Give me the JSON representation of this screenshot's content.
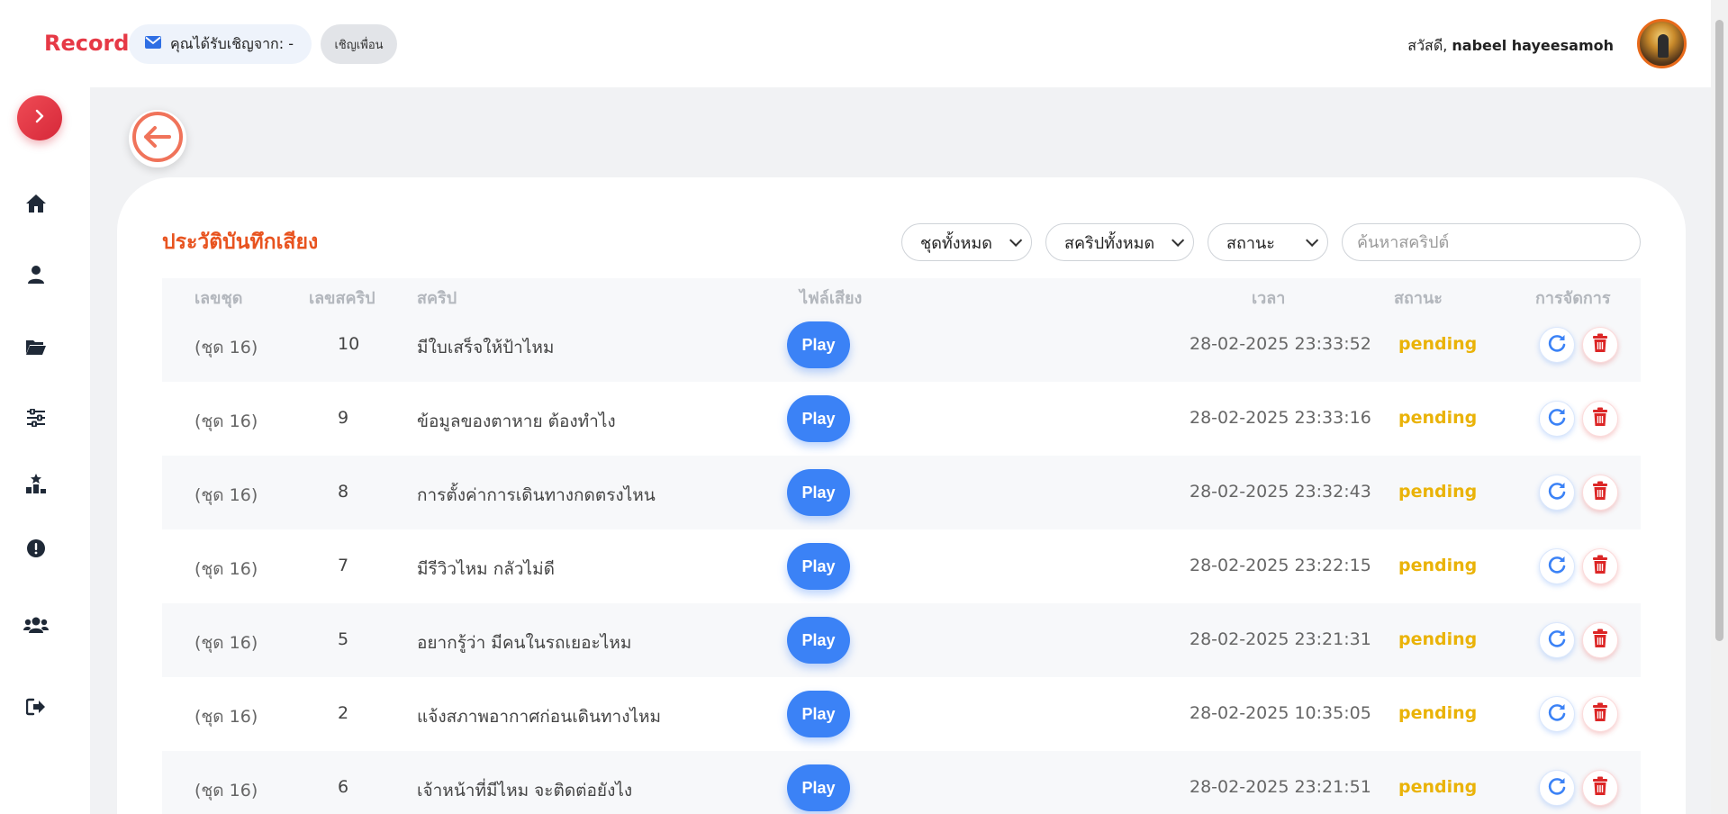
{
  "header": {
    "brand": "Record",
    "invite_text": "คุณได้รับเชิญจาก: -",
    "invite_button": "เชิญเพื่อน",
    "greeting_prefix": "สวัสดี,",
    "user_name": "nabeel hayeesamoh"
  },
  "sidebar": {
    "items": [
      {
        "icon": "home-icon"
      },
      {
        "icon": "user-icon"
      },
      {
        "icon": "folder-open-icon"
      },
      {
        "icon": "sliders-icon"
      },
      {
        "icon": "ranking-icon"
      },
      {
        "icon": "alert-circle-icon"
      },
      {
        "icon": "users-icon"
      },
      {
        "icon": "logout-icon"
      }
    ]
  },
  "main": {
    "title": "ประวัติบันทึกเสียง",
    "filters": {
      "set": "ชุดทั้งหมด",
      "script": "สคริปทั้งหมด",
      "status": "สถานะ",
      "search_placeholder": "ค้นหาสคริปต์"
    },
    "columns": [
      "เลขชุด",
      "เลขสคริป",
      "สคริป",
      "ไฟล์เสียง",
      "เวลา",
      "สถานะ",
      "การจัดการ"
    ],
    "rows": [
      {
        "set": "(ชุด 16)",
        "num": "10",
        "script": "มีใบเสร็จให้ป้าไหม",
        "play": "Play",
        "time": "28-02-2025 23:33:52",
        "status": "pending"
      },
      {
        "set": "(ชุด 16)",
        "num": "9",
        "script": "ข้อมูลของตาหาย ต้องทำไง",
        "play": "Play",
        "time": "28-02-2025 23:33:16",
        "status": "pending"
      },
      {
        "set": "(ชุด 16)",
        "num": "8",
        "script": "การตั้งค่าการเดินทางกดตรงไหน",
        "play": "Play",
        "time": "28-02-2025 23:32:43",
        "status": "pending"
      },
      {
        "set": "(ชุด 16)",
        "num": "7",
        "script": "มีรีวิวไหม กลัวไม่ดี",
        "play": "Play",
        "time": "28-02-2025 23:22:15",
        "status": "pending"
      },
      {
        "set": "(ชุด 16)",
        "num": "5",
        "script": "อยากรู้ว่า มีคนในรถเยอะไหม",
        "play": "Play",
        "time": "28-02-2025 23:21:31",
        "status": "pending"
      },
      {
        "set": "(ชุด 16)",
        "num": "2",
        "script": "แจ้งสภาพอากาศก่อนเดินทางไหม",
        "play": "Play",
        "time": "28-02-2025 10:35:05",
        "status": "pending"
      },
      {
        "set": "(ชุด 16)",
        "num": "6",
        "script": "เจ้าหน้าที่มีไหม จะติดต่อยังไง",
        "play": "Play",
        "time": "28-02-2025 23:21:51",
        "status": "pending"
      }
    ]
  },
  "colors": {
    "brand": "#e63946",
    "title": "#e8531f",
    "play": "#3b82f6",
    "pending": "#eab308",
    "refresh": "#3b82f6",
    "delete": "#dc2626"
  }
}
